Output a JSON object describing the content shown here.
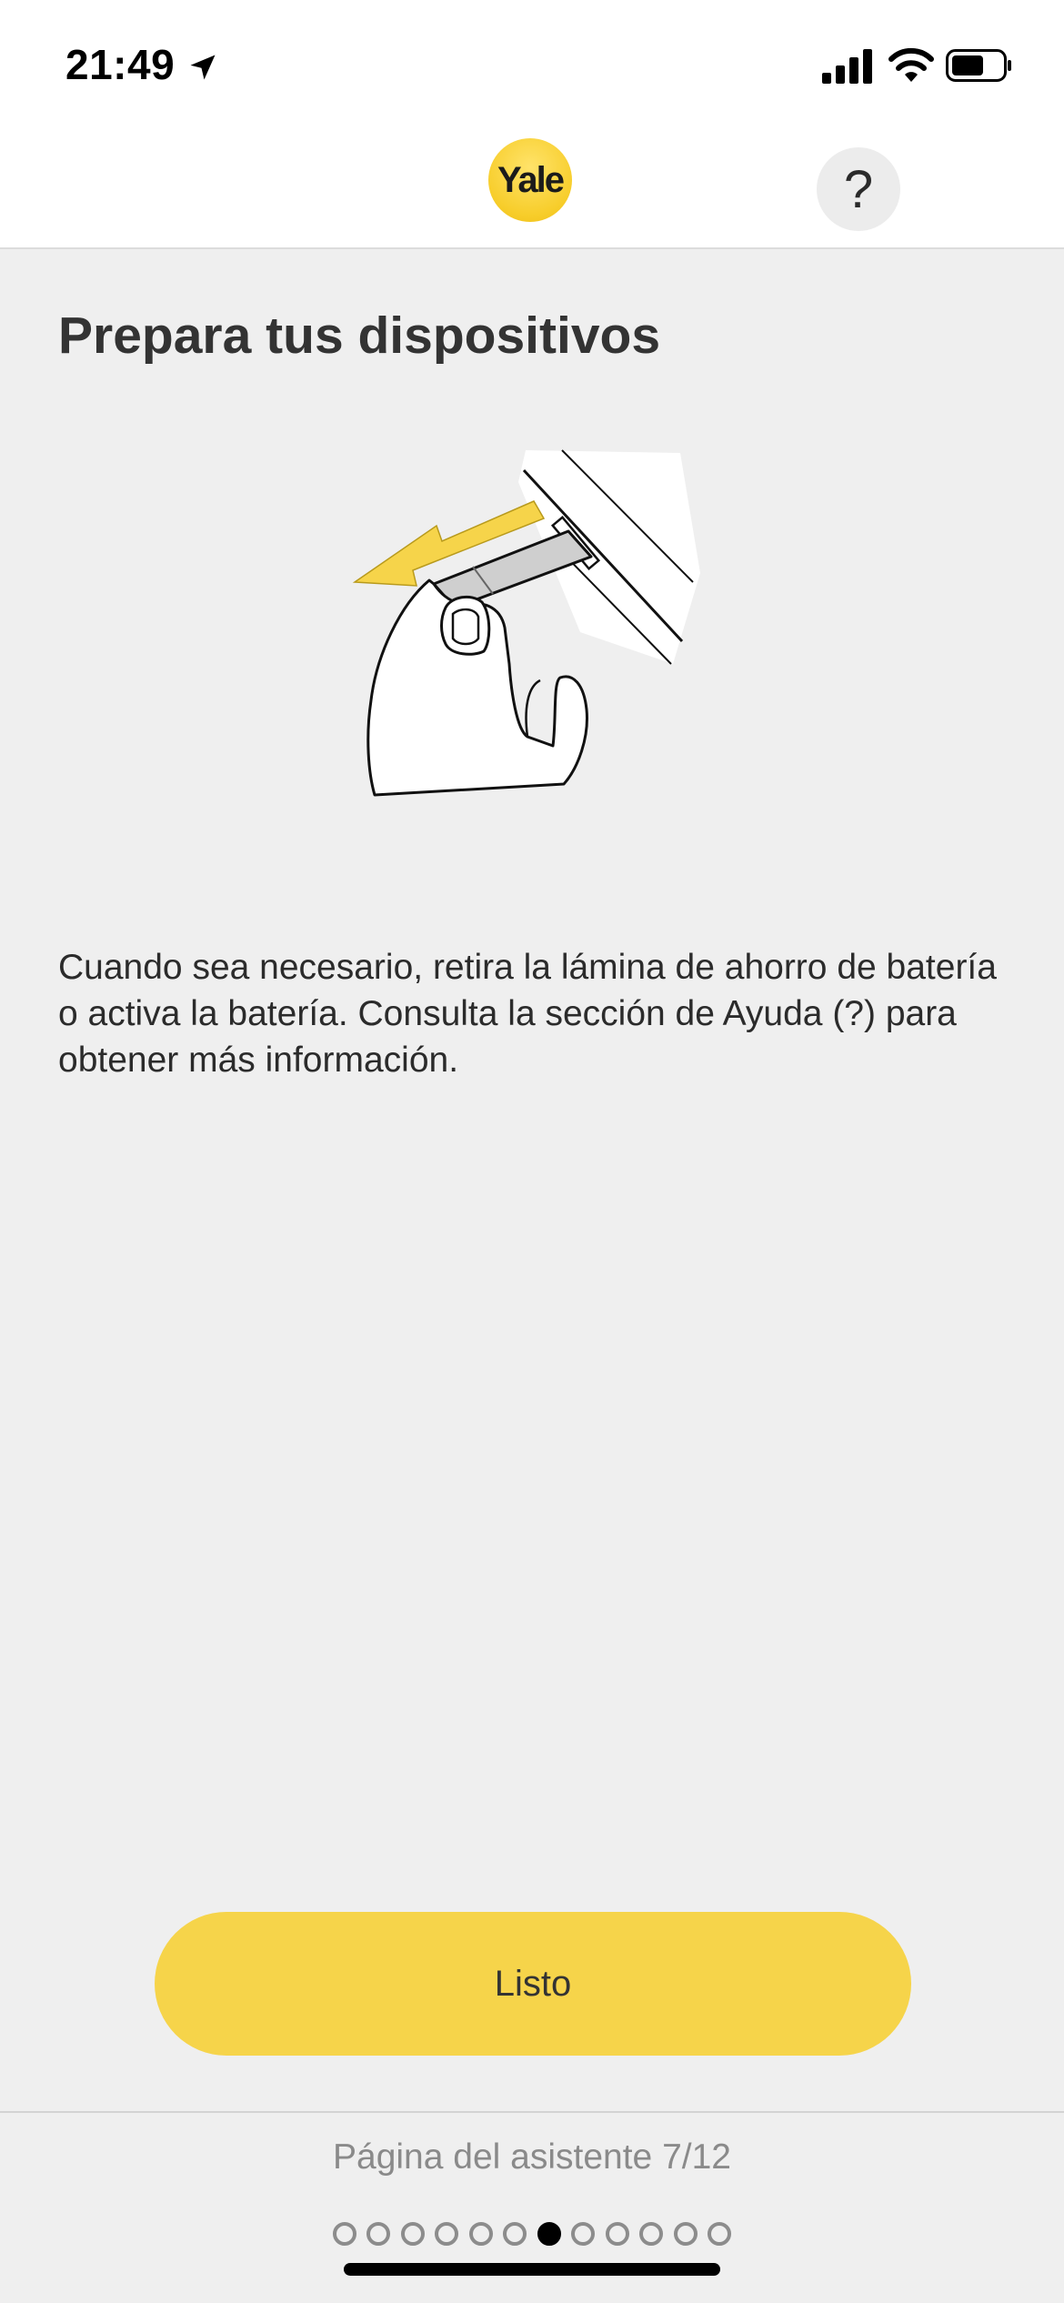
{
  "status_bar": {
    "time": "21:49",
    "icons": [
      "location-arrow-icon",
      "cellular-signal-icon",
      "wifi-icon",
      "battery-icon"
    ]
  },
  "header": {
    "logo_text": "Yale",
    "help_label": "?"
  },
  "main": {
    "title": "Prepara tus dispositivos",
    "illustration": "hand-pulling-battery-tab-illustration",
    "description": "Cuando sea necesario, retira la lámina de ahorro de batería o activa la batería. Consulta la sección de Ayuda (?) para obtener más información."
  },
  "actions": {
    "done_label": "Listo"
  },
  "footer": {
    "page_label": "Página del asistente 7/12",
    "current_page": 7,
    "total_pages": 12
  },
  "colors": {
    "accent_yellow": "#f6d44a",
    "background": "#efefef",
    "header_background": "#ffffff"
  }
}
